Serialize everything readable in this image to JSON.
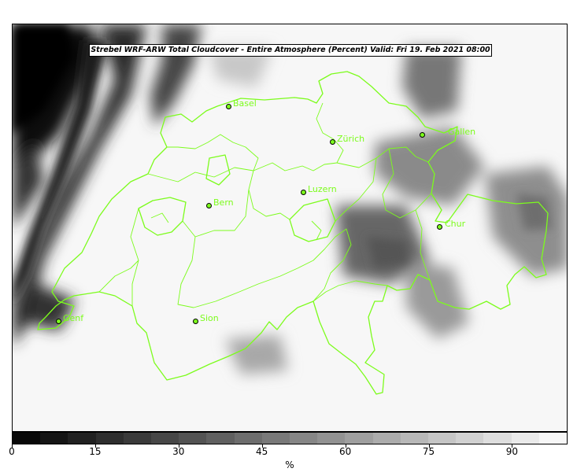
{
  "title": "Strebel WRF-ARW Total Cloudcover - Entire Atmosphere (Percent)   Valid: Fri 19. Feb 2021 08:00",
  "colors": {
    "border": "#7cfc1c",
    "background": "#f7f7f7"
  },
  "cities": [
    {
      "name": "Basel",
      "id": "basel"
    },
    {
      "name": "Zürich",
      "id": "zurich"
    },
    {
      "name": "St. Gallen",
      "id": "stgallen",
      "display": "Gallen"
    },
    {
      "name": "Luzern",
      "id": "luzern"
    },
    {
      "name": "Bern",
      "id": "bern"
    },
    {
      "name": "Chur",
      "id": "chur"
    },
    {
      "name": "Genf",
      "id": "genf"
    },
    {
      "name": "Sion",
      "id": "sion"
    }
  ],
  "colorbar": {
    "unit": "%",
    "min": 0,
    "max": 100,
    "step": 5,
    "ticks": [
      "0",
      "15",
      "30",
      "45",
      "60",
      "75",
      "90"
    ]
  }
}
